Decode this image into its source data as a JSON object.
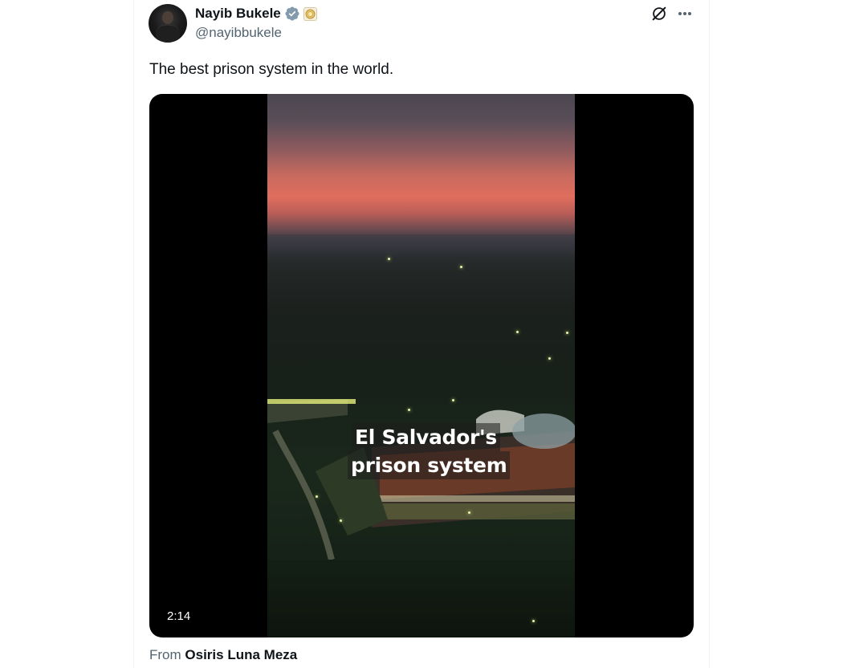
{
  "tweet": {
    "author": {
      "display_name": "Nayib Bukele",
      "handle": "@nayibbukele"
    },
    "icons": {
      "verified": "verified-badge-icon",
      "affiliate": "government-affiliate-badge-icon",
      "grok": "grok-icon",
      "more": "more-options-icon"
    },
    "text": "The best prison system in the world.",
    "media": {
      "type": "video",
      "duration": "2:14",
      "caption_line_1": "El Salvador's",
      "caption_line_2": "prison system"
    },
    "attribution": {
      "prefix": "From",
      "source": "Osiris Luna Meza"
    }
  },
  "colors": {
    "primary_text": "#0f1419",
    "secondary_text": "#536471",
    "verified_blue": "#1d9bf0",
    "media_background": "#000000"
  }
}
